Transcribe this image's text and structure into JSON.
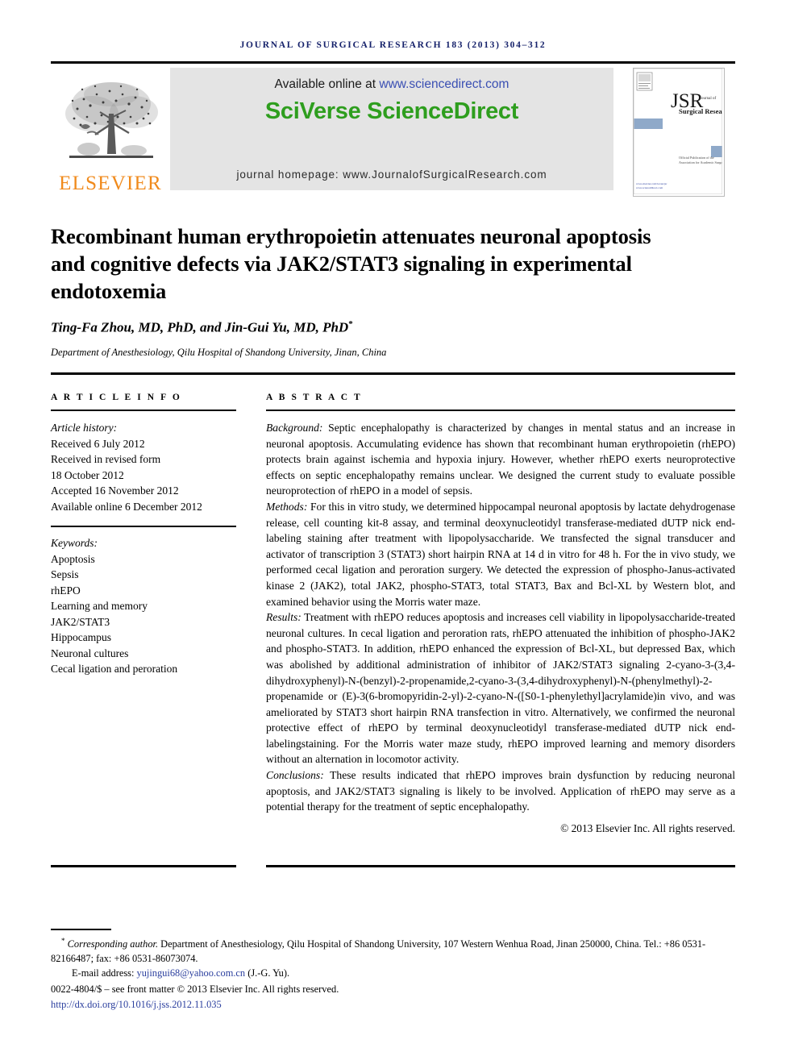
{
  "running_head": "Journal of Surgical Research 183 (2013) 304–312",
  "banner": {
    "available_prefix": "Available online at ",
    "sciencedirect_url": "www.sciencedirect.com",
    "brand": "SciVerse ScienceDirect",
    "homepage": "journal homepage: www.JournalofSurgicalResearch.com",
    "elsevier_wordmark": "ELSEVIER",
    "cover": {
      "acronym": "JSR",
      "line1": "Journal of",
      "line2": "Surgical Research",
      "footer1": "Official Publication of the",
      "footer2": "Association for Academic Surgery"
    }
  },
  "article": {
    "title": "Recombinant human erythropoietin attenuates neuronal apoptosis and cognitive defects via JAK2/STAT3 signaling in experimental endotoxemia",
    "authors": "Ting-Fa Zhou, MD, PhD, and Jin-Gui Yu, MD, PhD",
    "author_marker": "*",
    "affiliation": "Department of Anesthesiology, Qilu Hospital of Shandong University, Jinan, China"
  },
  "info": {
    "heading": "A R T I C L E   I N F O",
    "history_label": "Article history:",
    "history": [
      "Received 6 July 2012",
      "Received in revised form",
      "18 October 2012",
      "Accepted 16 November 2012",
      "Available online 6 December 2012"
    ],
    "keywords_label": "Keywords:",
    "keywords": [
      "Apoptosis",
      "Sepsis",
      "rhEPO",
      "Learning and memory",
      "JAK2/STAT3",
      "Hippocampus",
      "Neuronal cultures",
      "Cecal ligation and peroration"
    ]
  },
  "abstract": {
    "heading": "A B S T R A C T",
    "background_label": "Background:",
    "background_text": " Septic encephalopathy is characterized by changes in mental status and an increase in neuronal apoptosis. Accumulating evidence has shown that recombinant human erythropoietin (rhEPO) protects brain against ischemia and hypoxia injury. However, whether rhEPO exerts neuroprotective effects on septic encephalopathy remains unclear. We designed the current study to evaluate possible neuroprotection of rhEPO in a model of sepsis.",
    "methods_label": "Methods:",
    "methods_text": " For this in vitro study, we determined hippocampal neuronal apoptosis by lactate dehydrogenase release, cell counting kit-8 assay, and terminal deoxynucleotidyl transferase-mediated dUTP nick end-labeling staining after treatment with lipopolysaccharide. We transfected the signal transducer and activator of transcription 3 (STAT3) short hairpin RNA at 14 d in vitro for 48 h. For the in vivo study, we performed cecal ligation and peroration surgery. We detected the expression of phospho-Janus-activated kinase 2 (JAK2), total JAK2, phospho-STAT3, total STAT3, Bax and Bcl-XL by Western blot, and examined behavior using the Morris water maze.",
    "results_label": "Results:",
    "results_text": " Treatment with rhEPO reduces apoptosis and increases cell viability in lipopolysaccharide-treated neuronal cultures. In cecal ligation and peroration rats, rhEPO attenuated the inhibition of phospho-JAK2 and phospho-STAT3. In addition, rhEPO enhanced the expression of Bcl-XL, but depressed Bax, which was abolished by additional administration of inhibitor of JAK2/STAT3 signaling 2-cyano-3-(3,4-dihydroxyphenyl)-N-(benzyl)-2-propenamide,2-cyano-3-(3,4-dihydroxyphenyl)-N-(phenylmethyl)-2-propenamide or (E)-3(6-bromopyridin-2-yl)-2-cyano-N-([S0-1-phenylethyl]acrylamide)in vivo, and was ameliorated by STAT3 short hairpin RNA transfection in vitro. Alternatively, we confirmed the neuronal protective effect of rhEPO by terminal deoxynucleotidyl transferase-mediated dUTP nick end-labelingstaining. For the Morris water maze study, rhEPO improved learning and memory disorders without an alternation in locomotor activity.",
    "conclusions_label": "Conclusions:",
    "conclusions_text": " These results indicated that rhEPO improves brain dysfunction by reducing neuronal apoptosis, and JAK2/STAT3 signaling is likely to be involved. Application of rhEPO may serve as a potential therapy for the treatment of septic encephalopathy.",
    "copyright": "© 2013 Elsevier Inc. All rights reserved."
  },
  "footnotes": {
    "corresponding_marker": "*",
    "corresponding_label": "Corresponding author.",
    "corresponding_text": " Department of Anesthesiology, Qilu Hospital of Shandong University, 107 Western Wenhua Road, Jinan 250000, China. Tel.: +86 0531-82166487; fax: +86 0531-86073074.",
    "email_label": "E-mail address: ",
    "email_address": "yujingui68@yahoo.com.cn",
    "email_suffix": " (J.-G. Yu).",
    "front_matter": "0022-4804/$ – see front matter © 2013 Elsevier Inc. All rights reserved.",
    "doi": "http://dx.doi.org/10.1016/j.jss.2012.11.035"
  },
  "colors": {
    "runhead": "#16226b",
    "sciencedirect_green": "#2e9e1e",
    "link_blue": "#2b3f9e",
    "elsevier_orange": "#f08a1c",
    "banner_bg": "#e4e4e4"
  }
}
